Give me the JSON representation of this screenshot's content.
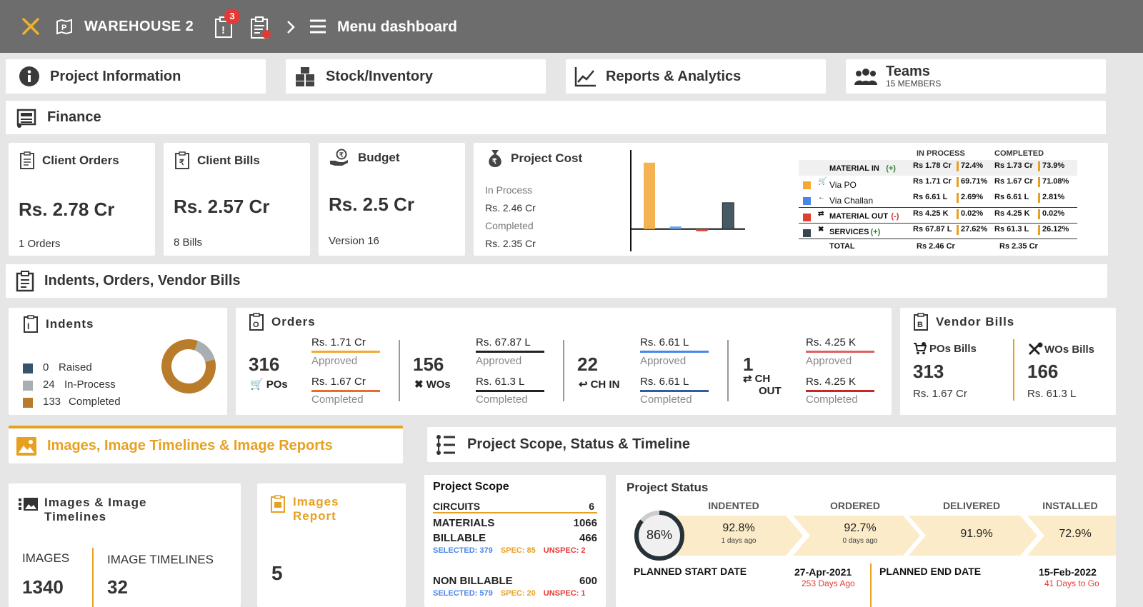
{
  "topbar": {
    "warehouse": "WAREHOUSE 2",
    "alert_count": "3",
    "title": "Menu dashboard",
    "icons": [
      "close-icon",
      "warehouse-icon",
      "alert-clipboard-icon",
      "clipboard-badge-icon",
      "chevron-right-icon",
      "menu-icon"
    ]
  },
  "nav": {
    "project_info": "Project Information",
    "stock": "Stock/Inventory",
    "reports": "Reports & Analytics",
    "teams": "Teams",
    "teams_sub": "15 MEMBERS",
    "finance": "Finance"
  },
  "finance": {
    "client_orders": {
      "label": "Client Orders",
      "value": "Rs. 2.78 Cr",
      "sub": "1 Orders"
    },
    "client_bills": {
      "label": "Client Bills",
      "value": "Rs. 2.57 Cr",
      "sub": "8 Bills"
    },
    "budget": {
      "label": "Budget",
      "value": "Rs. 2.5 Cr",
      "sub": "Version 16"
    },
    "project_cost": {
      "label": "Project Cost",
      "in_process_label": "In Process",
      "in_process_value": "Rs. 2.46 Cr",
      "completed_label": "Completed",
      "completed_value": "Rs. 2.35 Cr"
    },
    "table": {
      "col_in_process": "IN PROCESS",
      "col_completed": "COMPLETED",
      "rows": [
        {
          "label": "MATERIAL IN",
          "sign": "(+)",
          "sign_color": "#2e7d32",
          "ip_val": "Rs 1.78 Cr",
          "ip_pct": "72.4%",
          "c_val": "Rs 1.73 Cr",
          "c_pct": "73.9%",
          "color": "",
          "bold": true
        },
        {
          "label": "Via PO",
          "sign": "",
          "sign_color": "",
          "ip_val": "Rs 1.71 Cr",
          "ip_pct": "69.71%",
          "c_val": "Rs 1.67 Cr",
          "c_pct": "71.08%",
          "color": "#f4a833",
          "bold": false
        },
        {
          "label": "Via Challan",
          "sign": "",
          "sign_color": "",
          "ip_val": "Rs 6.61 L",
          "ip_pct": "2.69%",
          "c_val": "Rs 6.61 L",
          "c_pct": "2.81%",
          "color": "#4a86e8",
          "bold": false
        },
        {
          "label": "MATERIAL OUT",
          "sign": "(-)",
          "sign_color": "#d32f2f",
          "ip_val": "Rs 4.25 K",
          "ip_pct": "0.02%",
          "c_val": "Rs 4.25 K",
          "c_pct": "0.02%",
          "color": "#e04030",
          "bold": true
        },
        {
          "label": "SERVICES",
          "sign": "(+)",
          "sign_color": "#2e7d32",
          "ip_val": "Rs 67.87 L",
          "ip_pct": "27.62%",
          "c_val": "Rs 61.3 L",
          "c_pct": "26.12%",
          "color": "#37474f",
          "bold": true
        }
      ],
      "total_label": "TOTAL",
      "total_ip": "Rs 2.46 Cr",
      "total_c": "Rs 2.35 Cr"
    }
  },
  "chart_data": {
    "type": "bar",
    "categories": [
      "Via PO",
      "Via Challan",
      "Material Out",
      "Services"
    ],
    "values": [
      1.71,
      0.0661,
      -0.0425,
      0.6787
    ],
    "colors": [
      "#f4b350",
      "#6fa0e8",
      "#e04030",
      "#455a64"
    ],
    "ylim": [
      -0.5,
      2.0
    ],
    "title": "",
    "xlabel": "",
    "ylabel": ""
  },
  "indents_section": {
    "title": "Indents, Orders, Vendor Bills"
  },
  "indents": {
    "title": "Indents",
    "items": [
      {
        "count": "0",
        "label": "Raised",
        "color": "#37546e"
      },
      {
        "count": "24",
        "label": "In-Process",
        "color": "#a9aeb2"
      },
      {
        "count": "133",
        "label": "Completed",
        "color": "#b87c2a"
      }
    ],
    "donut": [
      0,
      24,
      133
    ]
  },
  "orders": {
    "title": "Orders",
    "groups": [
      {
        "count": "316",
        "unit": "POs",
        "top_val": "Rs. 1.71 Cr",
        "top_lbl": "Approved",
        "top_color": "#f4a833",
        "bot_val": "Rs. 1.67 Cr",
        "bot_lbl": "Completed",
        "bot_color": "#e86c2c",
        "icon": "cart-icon"
      },
      {
        "count": "156",
        "unit": "WOs",
        "top_val": "Rs. 67.87 L",
        "top_lbl": "Approved",
        "top_color": "#222",
        "bot_val": "Rs. 61.3 L",
        "bot_lbl": "Completed",
        "bot_color": "#222",
        "icon": "tools-icon"
      },
      {
        "count": "22",
        "unit": "CH IN",
        "top_val": "Rs. 6.61 L",
        "top_lbl": "Approved",
        "top_color": "#4a86e8",
        "bot_val": "Rs. 6.61 L",
        "bot_lbl": "Completed",
        "bot_color": "#2c5ea8",
        "icon": "arrow-left-icon"
      },
      {
        "count": "1",
        "unit": "CH",
        "unit2": "OUT",
        "top_val": "Rs. 4.25 K",
        "top_lbl": "Approved",
        "top_color": "#e06060",
        "bot_val": "Rs. 4.25 K",
        "bot_lbl": "Completed",
        "bot_color": "#c62828",
        "icon": "swap-icon"
      }
    ]
  },
  "vendor_bills": {
    "title": "Vendor Bills",
    "pos_label": "POs Bills",
    "pos_count": "313",
    "pos_value": "Rs. 1.67 Cr",
    "wos_label": "WOs Bills",
    "wos_count": "166",
    "wos_value": "Rs. 61.3 L"
  },
  "images_tab": {
    "title": "Images, Image Timelines & Image Reports",
    "accent": "#e8a020"
  },
  "scope_tab": {
    "title": "Project Scope, Status & Timeline"
  },
  "images_card": {
    "title1": "Images & Image",
    "title2": "Timelines",
    "images_label": "IMAGES",
    "images_value": "1340",
    "timelines_label": "IMAGE TIMELINES",
    "timelines_value": "32"
  },
  "images_report": {
    "title1": "Images",
    "title2": "Report",
    "value": "5"
  },
  "project_scope": {
    "title": "Project Scope",
    "circuits_label": "CIRCUITS",
    "circuits_value": "6",
    "materials_label": "MATERIALS",
    "materials_value": "1066",
    "billable_label": "BILLABLE",
    "billable_value": "466",
    "billable_selected": "SELECTED: 379",
    "billable_spec": "SPEC: 85",
    "billable_unspec": "UNSPEC: 2",
    "nonbillable_label": "NON BILLABLE",
    "nonbillable_value": "600",
    "nb_selected": "SELECTED: 579",
    "nb_spec": "SPEC: 20",
    "nb_unspec": "UNSPEC: 1"
  },
  "project_status": {
    "title": "Project Status",
    "overall": "86%",
    "overall_fraction": 0.86,
    "stages": [
      {
        "label": "INDENTED",
        "pct": "92.8%",
        "sub": "1 days ago"
      },
      {
        "label": "ORDERED",
        "pct": "92.7%",
        "sub": "0 days ago"
      },
      {
        "label": "DELIVERED",
        "pct": "91.9%",
        "sub": ""
      },
      {
        "label": "INSTALLED",
        "pct": "72.9%",
        "sub": ""
      }
    ],
    "start_label": "PLANNED START DATE",
    "start_date": "27-Apr-2021",
    "start_sub": "253 Days Ago",
    "end_label": "PLANNED END DATE",
    "end_date": "15-Feb-2022",
    "end_sub": "41 Days to Go"
  }
}
